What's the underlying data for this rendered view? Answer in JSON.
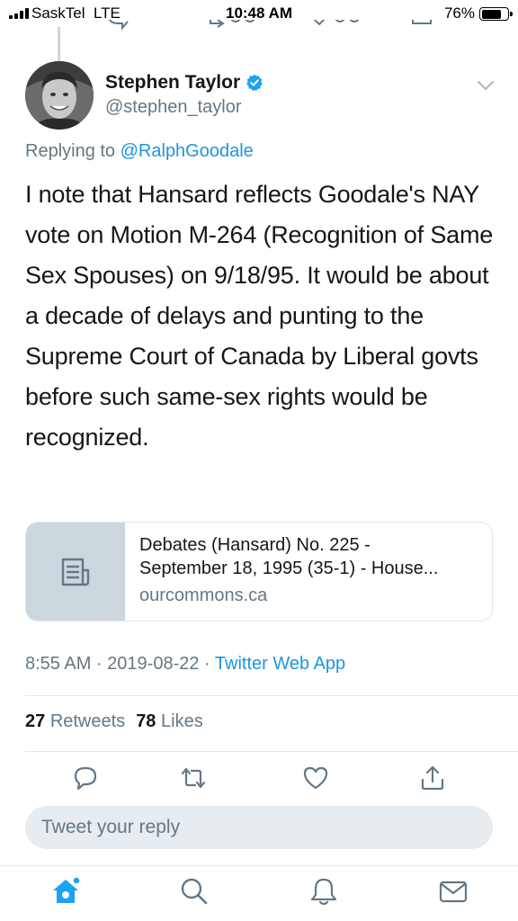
{
  "status_bar": {
    "carrier": "SaskTel",
    "network": "LTE",
    "time": "10:48 AM",
    "battery": "76%"
  },
  "tweet": {
    "display_name": "Stephen Taylor",
    "handle": "@stephen_taylor",
    "replying_prefix": "Replying to",
    "replying_to": "@RalphGoodale",
    "text": "I note that Hansard reflects Goodale's NAY vote on Motion M-264 (Recognition of Same Sex Spouses) on 9/18/95. It would be about a decade of delays and punting to the Supreme Court of Canada by Liberal govts before such same-sex rights would be recognized.",
    "card": {
      "title_line1": "Debates (Hansard) No. 225 -",
      "title_line2": "September 18, 1995 (35-1) - House...",
      "domain": "ourcommons.ca"
    },
    "time": "8:55 AM",
    "date": "2019-08-22",
    "source": "Twitter Web App",
    "retweets_count": "27",
    "retweets_label": "Retweets",
    "likes_count": "78",
    "likes_label": "Likes"
  },
  "reply_box": {
    "placeholder": "Tweet your reply"
  },
  "icons": {
    "verified": "verified-badge-icon",
    "caret": "chevron-down-icon",
    "card": "document-icon",
    "reply": "reply-icon",
    "retweet": "retweet-icon",
    "like": "heart-icon",
    "share": "share-icon",
    "home": "home-icon",
    "search": "search-icon",
    "notifications": "bell-icon",
    "messages": "mail-icon"
  },
  "colors": {
    "accent": "#1da1f2",
    "link": "#1b95e0",
    "secondary_text": "#657786"
  }
}
